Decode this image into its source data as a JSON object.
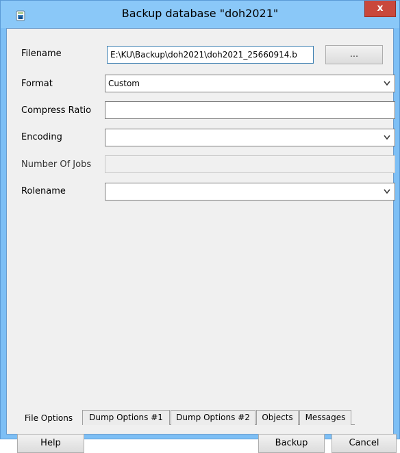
{
  "window": {
    "title": "Backup database \"doh2021\"",
    "close_label": "x"
  },
  "form": {
    "filename": {
      "label": "Filename",
      "value": "E:\\KU\\Backup\\doh2021\\doh2021_25660914.b"
    },
    "browse_label": "...",
    "format": {
      "label": "Format",
      "value": "Custom"
    },
    "compress_ratio": {
      "label": "Compress Ratio",
      "value": ""
    },
    "encoding": {
      "label": "Encoding",
      "value": ""
    },
    "number_of_jobs": {
      "label": "Number Of Jobs",
      "value": ""
    },
    "rolename": {
      "label": "Rolename",
      "value": ""
    }
  },
  "tabs": [
    {
      "label": "File Options",
      "active": true
    },
    {
      "label": "Dump Options #1",
      "active": false
    },
    {
      "label": "Dump Options #2",
      "active": false
    },
    {
      "label": "Objects",
      "active": false
    },
    {
      "label": "Messages",
      "active": false
    }
  ],
  "buttons": {
    "help": "Help",
    "backup": "Backup",
    "cancel": "Cancel"
  },
  "colors": {
    "titlebar": "#8ac8f8",
    "close_button": "#c9483c",
    "client_bg": "#f0f0f0"
  }
}
